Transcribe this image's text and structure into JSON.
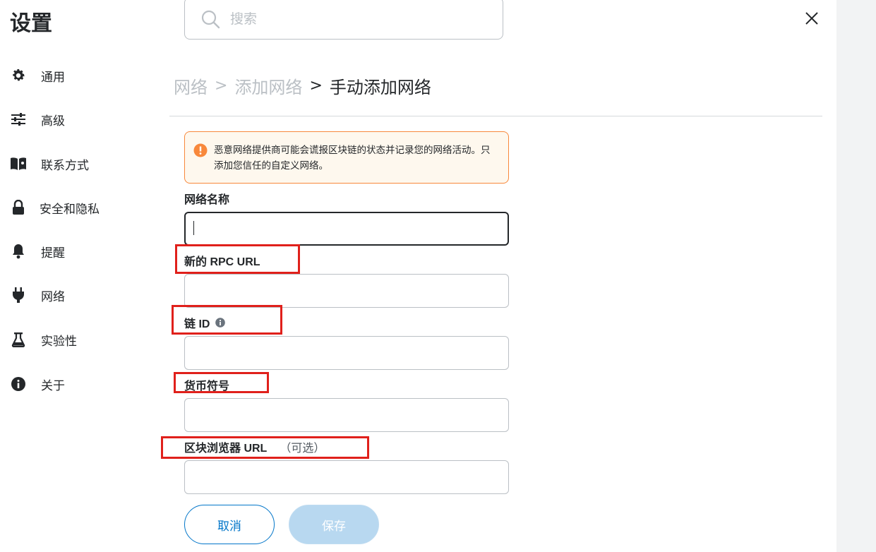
{
  "page": {
    "title": "设置"
  },
  "search": {
    "placeholder": "搜索"
  },
  "sidebar": {
    "items": [
      {
        "label": "通用",
        "icon": "gear-icon"
      },
      {
        "label": "高级",
        "icon": "sliders-icon"
      },
      {
        "label": "联系方式",
        "icon": "book-icon"
      },
      {
        "label": "安全和隐私",
        "icon": "lock-icon"
      },
      {
        "label": "提醒",
        "icon": "bell-icon"
      },
      {
        "label": "网络",
        "icon": "plug-icon"
      },
      {
        "label": "实验性",
        "icon": "flask-icon"
      },
      {
        "label": "关于",
        "icon": "info-icon"
      }
    ]
  },
  "breadcrumb": {
    "items": [
      "网络",
      "添加网络",
      "手动添加网络"
    ],
    "separator": ">"
  },
  "warning": {
    "text": "恶意网络提供商可能会谎报区块链的状态并记录您的网络活动。只添加您信任的自定义网络。"
  },
  "form": {
    "network_name": {
      "label": "网络名称",
      "value": ""
    },
    "rpc_url": {
      "label": "新的 RPC URL",
      "value": ""
    },
    "chain_id": {
      "label": "链 ID",
      "value": ""
    },
    "currency_symbol": {
      "label": "货币符号",
      "value": ""
    },
    "block_explorer": {
      "label": "区块浏览器 URL",
      "optional": "（可选）",
      "value": ""
    }
  },
  "buttons": {
    "cancel": "取消",
    "save": "保存"
  },
  "colors": {
    "primary": "#0376c9",
    "warning_border": "#f8883b",
    "warning_bg": "#fef8ee",
    "highlight": "#e0201b",
    "save_disabled": "#b8d8f0"
  }
}
